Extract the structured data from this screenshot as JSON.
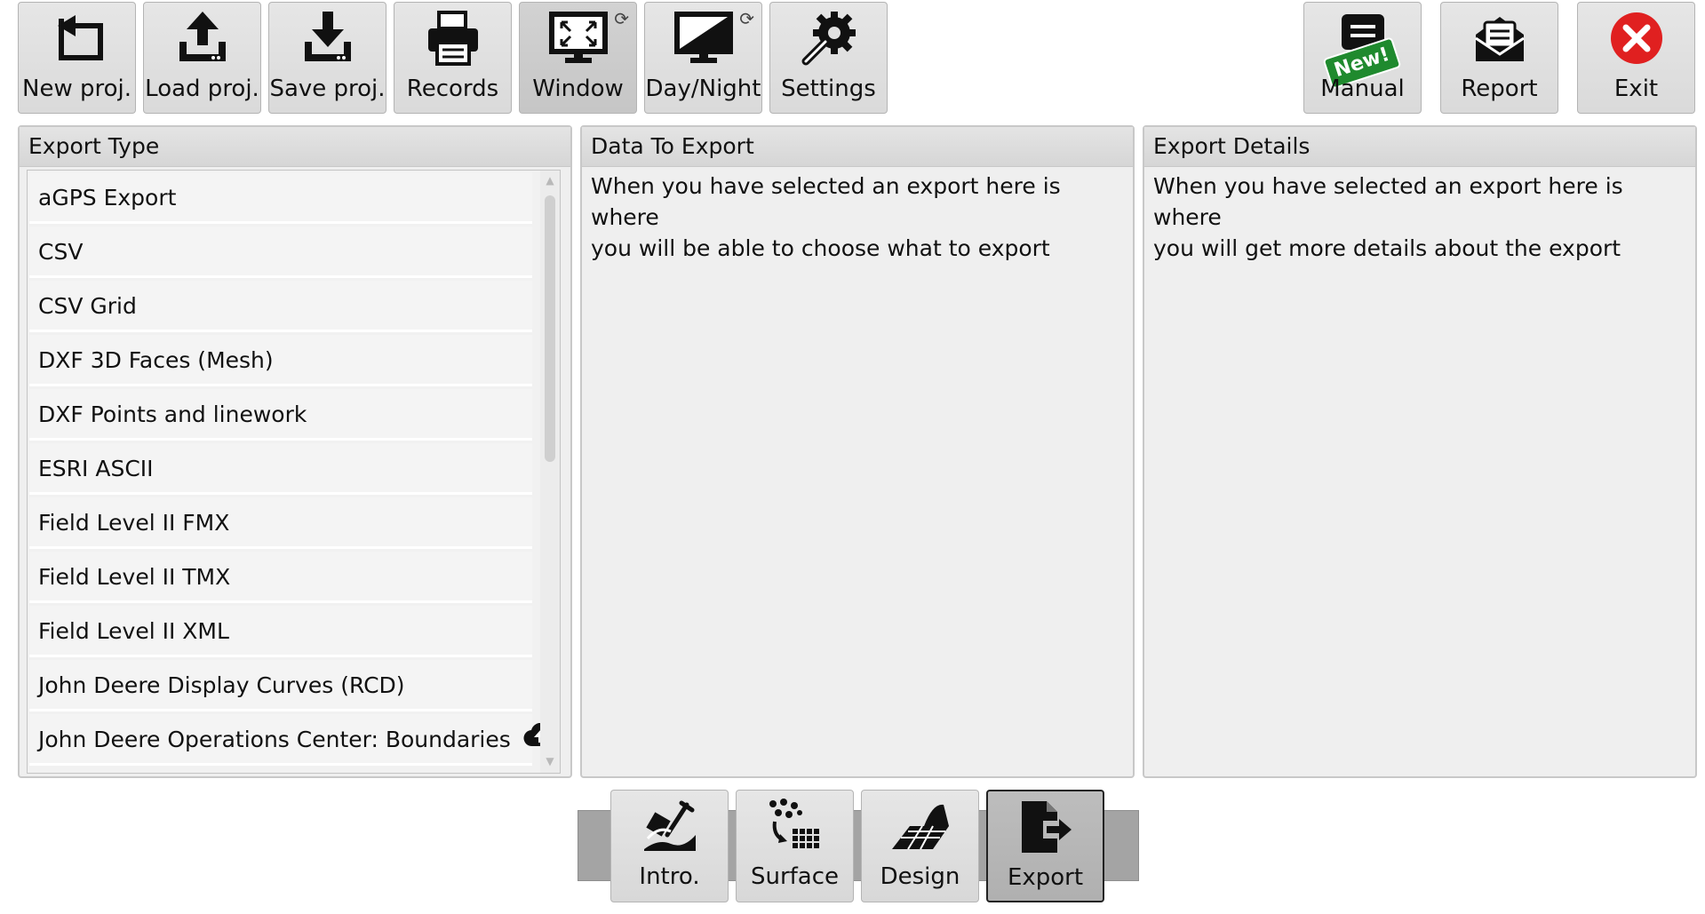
{
  "toolbar": {
    "left": [
      {
        "label": "New proj.",
        "icon": "undo-arrow-icon"
      },
      {
        "label": "Load proj.",
        "icon": "upload-icon"
      },
      {
        "label": "Save proj.",
        "icon": "download-icon"
      },
      {
        "label": "Records",
        "icon": "printer-icon"
      },
      {
        "label": "Window",
        "icon": "window-mode-icon"
      },
      {
        "label": "Day/Night",
        "icon": "day-night-icon"
      },
      {
        "label": "Settings",
        "icon": "gear-wrench-icon"
      }
    ],
    "right": [
      {
        "label": "Manual",
        "icon": "manual-icon",
        "badge": "New!"
      },
      {
        "label": "Report",
        "icon": "report-envelope-icon"
      },
      {
        "label": "Exit",
        "icon": "exit-x-icon"
      }
    ]
  },
  "panels": {
    "export_type": {
      "title": "Export Type",
      "items": [
        "aGPS Export",
        "CSV",
        "CSV Grid",
        "DXF 3D Faces (Mesh)",
        "DXF Points and linework",
        "ESRI ASCII",
        "Field Level II FMX",
        "Field Level II TMX",
        "Field Level II XML",
        "John Deere Display Curves (RCD)",
        "John Deere Operations Center: Boundaries"
      ]
    },
    "data_to_export": {
      "title": "Data To Export",
      "text_line1": "When you have selected an export here is where",
      "text_line2": "you will be able to choose what to export"
    },
    "export_details": {
      "title": "Export Details",
      "text_line1": "When you have selected an export here is where",
      "text_line2": "you will get more details about the export"
    }
  },
  "bottom_tabs": [
    {
      "label": "Intro.",
      "icon": "intro-shovel-icon"
    },
    {
      "label": "Surface",
      "icon": "surface-grid-icon"
    },
    {
      "label": "Design",
      "icon": "design-plane-icon"
    },
    {
      "label": "Export",
      "icon": "export-file-icon",
      "selected": true
    }
  ],
  "colors": {
    "exit_red": "#e02020",
    "new_badge_green": "#1f8a2e",
    "selected_tab": "#b5b5b5"
  }
}
